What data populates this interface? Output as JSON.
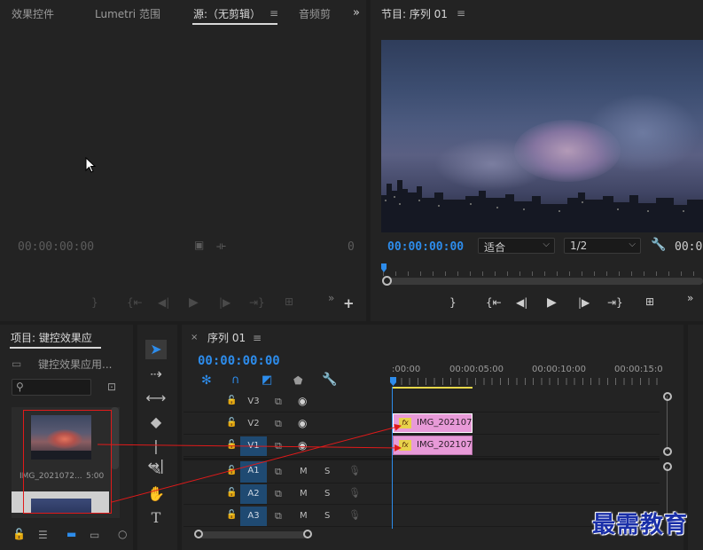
{
  "source_panel": {
    "tabs": [
      "效果控件",
      "Lumetri 范围",
      "源:（无剪辑）",
      "音频剪"
    ],
    "timecode_left": "00:00:00:00",
    "timecode_right": "0"
  },
  "program_panel": {
    "title": "节目: 序列 01",
    "timecode": "00:00:00:00",
    "fit_label": "适合",
    "quality_label": "1/2",
    "timecode_right": "00:0"
  },
  "project_panel": {
    "title": "项目: 键控效果应",
    "folder_label": "键控效果应用...",
    "search_placeholder": "",
    "clip_name": "IMG_2021072...",
    "clip_duration": "5:00"
  },
  "timeline": {
    "tab_label": "序列 01",
    "timecode": "00:00:00:00",
    "ruler": [
      ":00:00",
      "00:00:05:00",
      "00:00:10:00",
      "00:00:15:0"
    ],
    "video_tracks": [
      "V3",
      "V2",
      "V1"
    ],
    "audio_tracks": [
      "A1",
      "A2",
      "A3"
    ],
    "mute_label": "M",
    "solo_label": "S",
    "clips": [
      {
        "name": "IMG_202107",
        "track": "V2",
        "fx": "fx"
      },
      {
        "name": "IMG_2021072",
        "track": "V1",
        "fx": "fx"
      }
    ],
    "accent_color": "#2d8ceb",
    "clip_color": "#e89ad8"
  },
  "watermark": "最需教育"
}
